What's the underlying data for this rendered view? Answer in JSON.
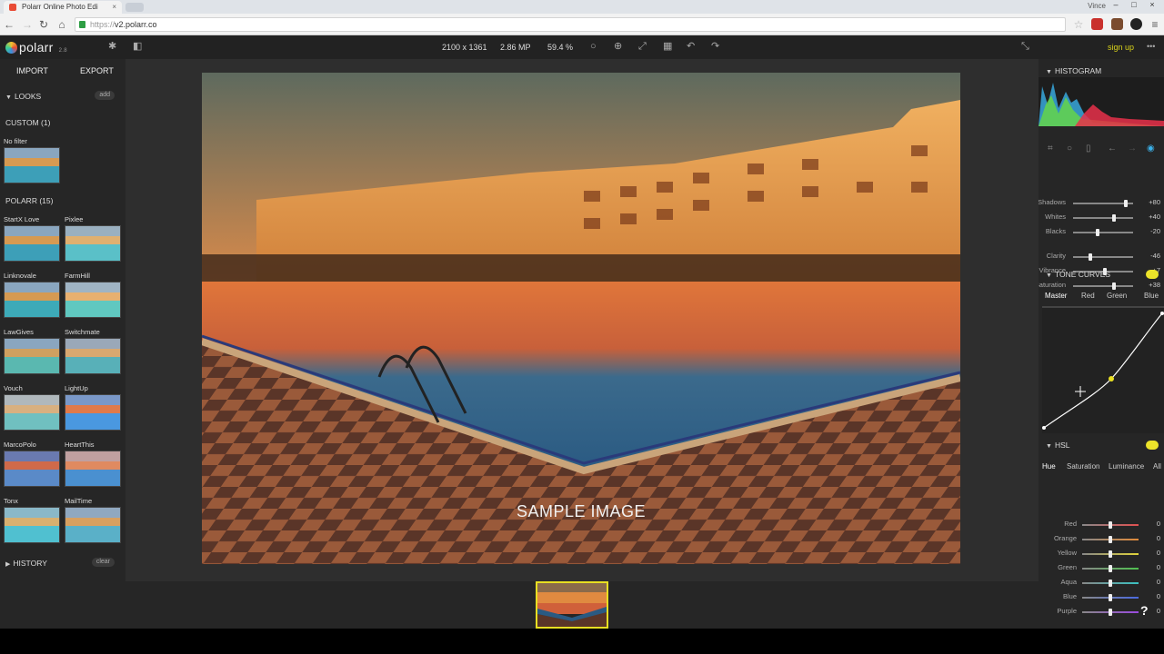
{
  "browser": {
    "tab_title": "Polarr Online Photo Edi",
    "tab_close": "×",
    "user": "Vince",
    "url_scheme": "https://",
    "url_host": "v2.polarr.co",
    "win_min": "–",
    "win_max": "□",
    "win_close": "×"
  },
  "app": {
    "brand": "polarr",
    "version": "2.8",
    "dimensions": "2100 x 1361",
    "megapixels": "2.86 MP",
    "zoom": "59.4 %",
    "signup": "sign up",
    "more": "•••"
  },
  "left_panel": {
    "import": "IMPORT",
    "export": "EXPORT",
    "looks_header": "LOOKS",
    "add": "add",
    "custom_header": "CUSTOM (1)",
    "custom_items": [
      {
        "label": "No filter"
      }
    ],
    "polarr_header": "POLARR (15)",
    "polarr_items": [
      {
        "label": "StartX Love"
      },
      {
        "label": "Pixlee"
      },
      {
        "label": "Linknovale"
      },
      {
        "label": "FarmHill"
      },
      {
        "label": "LawGives"
      },
      {
        "label": "Switchmate"
      },
      {
        "label": "Vouch"
      },
      {
        "label": "LightUp"
      },
      {
        "label": "MarcoPolo"
      },
      {
        "label": "HeartThis"
      },
      {
        "label": "Tonx"
      },
      {
        "label": "MailTime"
      }
    ],
    "history_header": "HISTORY",
    "clear": "clear"
  },
  "canvas": {
    "watermark": "SAMPLE IMAGE"
  },
  "right_panel": {
    "histogram_header": "HISTOGRAM",
    "light_sliders": [
      {
        "name": "Shadows",
        "value": "+80",
        "position": 0.9
      },
      {
        "name": "Whites",
        "value": "+40",
        "position": 0.7
      },
      {
        "name": "Blacks",
        "value": "-20",
        "position": 0.4
      }
    ],
    "color_sliders": [
      {
        "name": "Clarity",
        "value": "-46",
        "position": 0.27
      },
      {
        "name": "Vibrance",
        "value": "+7",
        "position": 0.53
      },
      {
        "name": "Saturation",
        "value": "+38",
        "position": 0.69
      }
    ],
    "tone_curves_header": "TONE CURVES",
    "tone_tabs": [
      "Master",
      "Red",
      "Green",
      "Blue"
    ],
    "hsl_header": "HSL",
    "hsl_tabs": [
      "Hue",
      "Saturation",
      "Luminance",
      "All"
    ],
    "hsl_rows": [
      {
        "name": "Red",
        "value": "0",
        "color": "#e05050"
      },
      {
        "name": "Orange",
        "value": "0",
        "color": "#e08a3a"
      },
      {
        "name": "Yellow",
        "value": "0",
        "color": "#e0d33a"
      },
      {
        "name": "Green",
        "value": "0",
        "color": "#4fc04f"
      },
      {
        "name": "Aqua",
        "value": "0",
        "color": "#3ac0c0"
      },
      {
        "name": "Blue",
        "value": "0",
        "color": "#4a6ae0"
      },
      {
        "name": "Purple",
        "value": "0",
        "color": "#9a4ae0"
      }
    ]
  },
  "help": "?",
  "colors": {
    "accent": "#e8df22",
    "toggle": "#ece32a"
  }
}
